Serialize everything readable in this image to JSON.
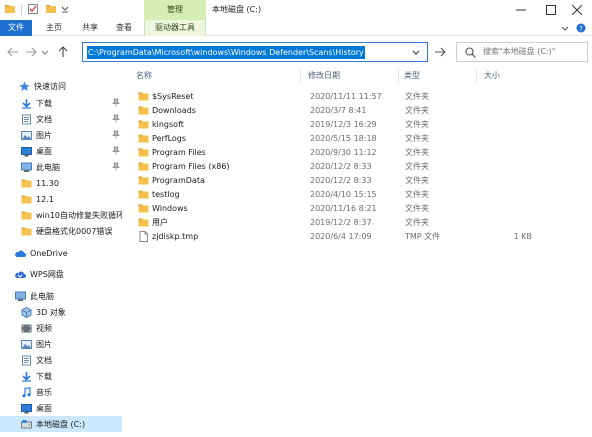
{
  "titlebar": {
    "context_tab_header": "管理",
    "title": "本地磁盘 (C:)",
    "quick_access_icons": [
      "folder-icon",
      "checkmark-icon",
      "new-folder-icon",
      "chevron-down-icon"
    ],
    "window_buttons": [
      "minimize-icon",
      "maximize-icon",
      "close-icon"
    ]
  },
  "ribbon": {
    "tabs": [
      {
        "label": "文件"
      },
      {
        "label": "主页"
      },
      {
        "label": "共享"
      },
      {
        "label": "查看"
      },
      {
        "label": "驱动器工具"
      }
    ],
    "file_tab_color": "#1e6fd0",
    "context_color": "#d8ecb6"
  },
  "address": {
    "path": "C:\\ProgramData\\Microsoft\\windows\\Windows Defender\\Scans\\History",
    "search_placeholder": "搜索\"本地磁盘 (C:)\""
  },
  "nav": {
    "items": [
      {
        "label": "快速访问",
        "icon": "star-icon"
      },
      {
        "label": "下载",
        "icon": "download-icon",
        "pinned": true
      },
      {
        "label": "文档",
        "icon": "document-icon",
        "pinned": true
      },
      {
        "label": "图片",
        "icon": "picture-icon",
        "pinned": true
      },
      {
        "label": "桌面",
        "icon": "desktop-icon",
        "pinned": true
      },
      {
        "label": "此电脑",
        "icon": "computer-icon",
        "pinned": true
      },
      {
        "label": "11.30",
        "icon": "folder-icon"
      },
      {
        "label": "12.1",
        "icon": "folder-icon"
      },
      {
        "label": "win10自动修复失败循环",
        "icon": "folder-icon"
      },
      {
        "label": "硬盘格式化0007错误",
        "icon": "folder-icon"
      },
      {
        "label": "OneDrive",
        "icon": "cloud-icon"
      },
      {
        "label": "WPS网盘",
        "icon": "wps-cloud-icon"
      },
      {
        "label": "此电脑",
        "icon": "computer-icon"
      },
      {
        "label": "3D 对象",
        "icon": "cube-icon"
      },
      {
        "label": "视频",
        "icon": "video-icon"
      },
      {
        "label": "图片",
        "icon": "picture-icon"
      },
      {
        "label": "文档",
        "icon": "document-icon"
      },
      {
        "label": "下载",
        "icon": "download-icon"
      },
      {
        "label": "音乐",
        "icon": "music-icon"
      },
      {
        "label": "桌面",
        "icon": "desktop-icon"
      },
      {
        "label": "本地磁盘 (C:)",
        "icon": "drive-icon",
        "selected": true
      }
    ]
  },
  "files": {
    "columns": [
      "名称",
      "修改日期",
      "类型",
      "大小"
    ],
    "rows": [
      {
        "name": "$SysReset",
        "date": "2020/11/11 11:57",
        "type": "文件夹",
        "size": "",
        "icon": "folder-icon"
      },
      {
        "name": "Downloads",
        "date": "2020/3/7 8:41",
        "type": "文件夹",
        "size": "",
        "icon": "folder-icon"
      },
      {
        "name": "kingsoft",
        "date": "2019/12/3 16:29",
        "type": "文件夹",
        "size": "",
        "icon": "folder-icon"
      },
      {
        "name": "PerfLogs",
        "date": "2020/5/15 18:18",
        "type": "文件夹",
        "size": "",
        "icon": "folder-icon"
      },
      {
        "name": "Program Files",
        "date": "2020/9/30 11:12",
        "type": "文件夹",
        "size": "",
        "icon": "folder-icon"
      },
      {
        "name": "Program Files (x86)",
        "date": "2020/12/2 8:33",
        "type": "文件夹",
        "size": "",
        "icon": "folder-icon"
      },
      {
        "name": "ProgramData",
        "date": "2020/12/2 8:33",
        "type": "文件夹",
        "size": "",
        "icon": "folder-icon"
      },
      {
        "name": "testlog",
        "date": "2020/4/10 15:15",
        "type": "文件夹",
        "size": "",
        "icon": "folder-icon"
      },
      {
        "name": "Windows",
        "date": "2020/11/16 8:21",
        "type": "文件夹",
        "size": "",
        "icon": "folder-icon"
      },
      {
        "name": "用户",
        "date": "2019/12/2 8:37",
        "type": "文件夹",
        "size": "",
        "icon": "folder-icon"
      },
      {
        "name": "zjdiskp.tmp",
        "date": "2020/6/4 17:09",
        "type": "TMP 文件",
        "size": "1 KB",
        "icon": "file-icon"
      }
    ],
    "folder_color": "#f2c14e"
  }
}
